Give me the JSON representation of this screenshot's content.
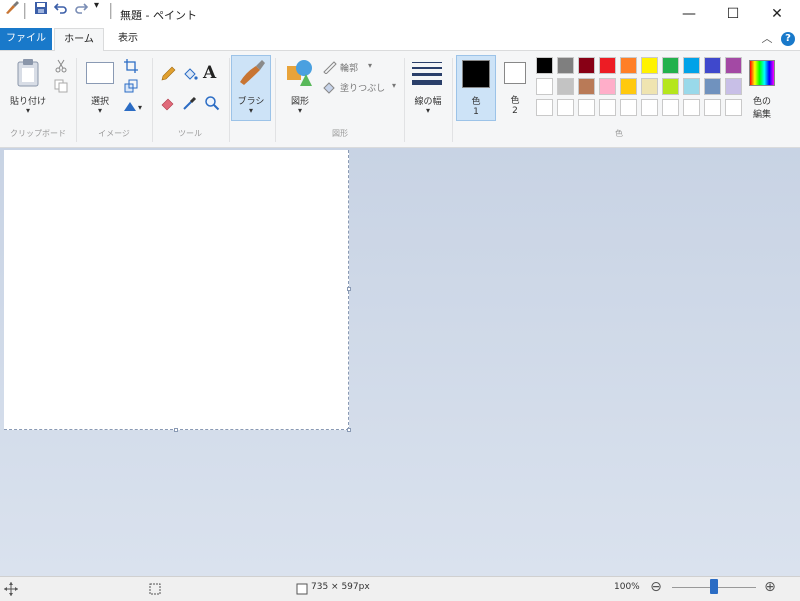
{
  "window": {
    "title": "無題 - ペイント"
  },
  "quick_access": {
    "dropdown_glyph": "▾",
    "separator": "|"
  },
  "window_controls": {
    "minimize": "—",
    "maximize": "☐",
    "close": "✕"
  },
  "tabs": {
    "file": "ファイル",
    "home": "ホーム",
    "view": "表示",
    "collapse": "︿",
    "help": "?"
  },
  "ribbon": {
    "clipboard": {
      "paste": "貼り付け",
      "group": "クリップボード"
    },
    "image": {
      "select": "選択",
      "group": "イメージ"
    },
    "tools": {
      "text_tool": "A",
      "group": "ツール"
    },
    "brush": {
      "label": "ブラシ"
    },
    "shapes": {
      "label": "図形",
      "outline": "輪郭",
      "fill": "塗りつぶし",
      "group": "図形"
    },
    "size": {
      "label": "線の幅"
    },
    "color1": {
      "line1": "色",
      "line2": "1"
    },
    "color2": {
      "line1": "色",
      "line2": "2"
    },
    "colors": {
      "group": "色"
    },
    "edit_colors": {
      "line1": "色の",
      "line2": "編集"
    },
    "dropdown_glyph": "▾"
  },
  "palette": {
    "row1": [
      "#000000",
      "#7f7f7f",
      "#880015",
      "#ed1c24",
      "#ff7f27",
      "#fff200",
      "#22b14c",
      "#00a2e8",
      "#3f48cc",
      "#a349a4"
    ],
    "row2": [
      "#ffffff",
      "#c3c3c3",
      "#b97a57",
      "#ffaec9",
      "#ffc90e",
      "#efe4b0",
      "#b5e61d",
      "#99d9ea",
      "#7092be",
      "#c8bfe7"
    ],
    "row3": [
      "#ffffff",
      "#ffffff",
      "#ffffff",
      "#ffffff",
      "#ffffff",
      "#ffffff",
      "#ffffff",
      "#ffffff",
      "#ffffff",
      "#ffffff"
    ]
  },
  "statusbar": {
    "image_size": "735 × 597px",
    "zoom": "100%",
    "zoom_out": "⊖",
    "zoom_in": "⊕",
    "zoom_level_fraction": 0.5
  },
  "colors": {
    "accent": "#1979ca",
    "color1": "#000000",
    "color2": "#ffffff"
  }
}
